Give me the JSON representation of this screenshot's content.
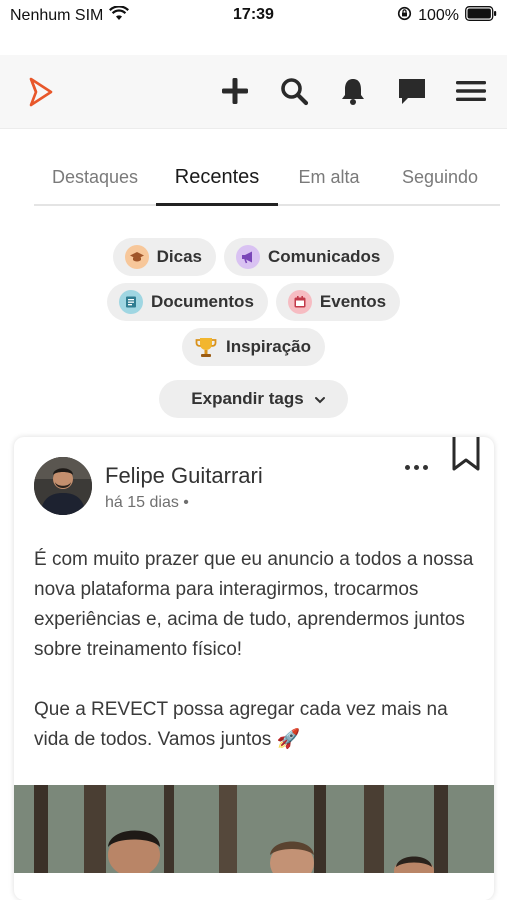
{
  "status_bar": {
    "carrier": "Nenhum SIM",
    "time": "17:39",
    "battery": "100%"
  },
  "header": {
    "logo_icon": "revect-logo-icon",
    "icons": [
      "plus-icon",
      "search-icon",
      "bell-icon",
      "chat-icon",
      "menu-icon"
    ]
  },
  "tabs": [
    {
      "label": "Destaques",
      "active": false
    },
    {
      "label": "Recentes",
      "active": true
    },
    {
      "label": "Em alta",
      "active": false
    },
    {
      "label": "Seguindo",
      "active": false
    }
  ],
  "tags": {
    "dicas": {
      "label": "Dicas",
      "icon": "graduation-cap-icon",
      "color": "#f3b27a"
    },
    "comunicados": {
      "label": "Comunicados",
      "icon": "megaphone-icon",
      "color": "#c8a8ea"
    },
    "documentos": {
      "label": "Documentos",
      "icon": "document-icon",
      "color": "#7fc6d6"
    },
    "eventos": {
      "label": "Eventos",
      "icon": "calendar-icon",
      "color": "#f2a0a8"
    },
    "inspiracao": {
      "label": "Inspiração",
      "icon": "trophy-icon",
      "color": "#f2b62e"
    },
    "expand_label": "Expandir tags"
  },
  "post": {
    "author": "Felipe Guitarrari",
    "time": "há 15 dias",
    "separator": "•",
    "paragraphs": [
      "É com muito prazer que eu anuncio a todos a nossa nova plataforma para interagirmos, trocarmos experiências e, acima de tudo, aprendermos juntos sobre treinamento físico!",
      "",
      "Que a REVECT possa agregar cada vez mais na vida de todos. Vamos juntos 🚀"
    ]
  },
  "colors": {
    "brand": "#e8572a",
    "active_tab": "#222222",
    "chip_bg": "#eeeeee"
  }
}
